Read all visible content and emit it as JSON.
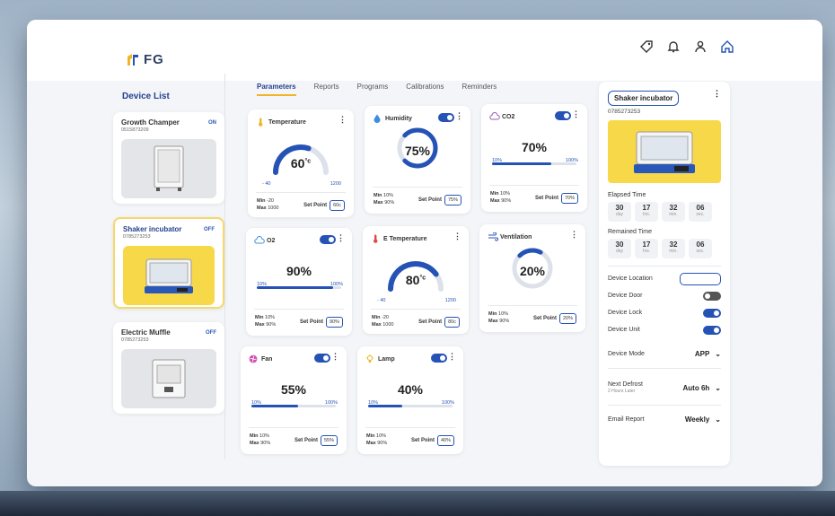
{
  "brand": {
    "logo_text": "FG",
    "accent": "#2553b5",
    "highlight": "#f7d849"
  },
  "top_icons": [
    "tag-icon",
    "bell-icon",
    "user-icon",
    "home-icon"
  ],
  "device_list": {
    "title": "Device List",
    "devices": [
      {
        "name": "Growth Champer",
        "id": "0515873209",
        "status": "ON"
      },
      {
        "name": "Shaker incubator",
        "id": "0785273253",
        "status": "OFF"
      },
      {
        "name": "Electric Muffle",
        "id": "0785273253",
        "status": "OFF"
      }
    ]
  },
  "tabs": [
    "Parameters",
    "Reports",
    "Programs",
    "Calibrations",
    "Reminders"
  ],
  "params": {
    "temperature": {
      "title": "Temperature",
      "value": "60",
      "unit": "°c",
      "gmin": "- 40",
      "gmax": "1200",
      "min": "-20",
      "max": "1000",
      "setpoint": "60c",
      "level": 0.6
    },
    "humidity": {
      "title": "Humidity",
      "value": "75%",
      "min": "10%",
      "max": "90%",
      "setpoint": "75%",
      "level": 0.75
    },
    "co2": {
      "title": "CO2",
      "value": "70%",
      "bmin": "10%",
      "bmax": "100%",
      "min": "10%",
      "max": "90%",
      "setpoint": "70%",
      "level": 0.7
    },
    "o2": {
      "title": "O2",
      "value": "90%",
      "bmin": "10%",
      "bmax": "100%",
      "min": "10%",
      "max": "90%",
      "setpoint": "90%",
      "level": 0.9
    },
    "etemp": {
      "title": "E Temperature",
      "value": "80",
      "unit": "°c",
      "gmin": "- 40",
      "gmax": "1200",
      "min": "-20",
      "max": "1000",
      "setpoint": "80c",
      "level": 0.8
    },
    "ventilation": {
      "title": "Ventilation",
      "value": "20%",
      "min": "10%",
      "max": "90%",
      "setpoint": "20%",
      "level": 0.2
    },
    "fan": {
      "title": "Fan",
      "value": "55%",
      "bmin": "10%",
      "bmax": "100%",
      "min": "10%",
      "max": "90%",
      "setpoint": "55%",
      "level": 0.55
    },
    "lamp": {
      "title": "Lamp",
      "value": "40%",
      "bmin": "10%",
      "bmax": "100%",
      "min": "10%",
      "max": "90%",
      "setpoint": "40%",
      "level": 0.4
    }
  },
  "labels": {
    "min": "Min",
    "max": "Max",
    "set_point": "Set Point"
  },
  "panel": {
    "title": "Shaker incubator",
    "id": "0785273253",
    "elapsed_label": "Elapsed Time",
    "remained_label": "Remained Time",
    "elapsed": [
      {
        "v": "30",
        "u": "day"
      },
      {
        "v": "17",
        "u": "hrs."
      },
      {
        "v": "32",
        "u": "min."
      },
      {
        "v": "06",
        "u": "sec."
      }
    ],
    "remained": [
      {
        "v": "30",
        "u": "day"
      },
      {
        "v": "17",
        "u": "hrs."
      },
      {
        "v": "32",
        "u": "min."
      },
      {
        "v": "06",
        "u": "sec."
      }
    ],
    "location": "Device Location",
    "door": "Device Door",
    "lock": "Device Lock",
    "unit": "Device Unit",
    "mode_label": "Device Mode",
    "mode_value": "APP",
    "defrost_label": "Next Defrost",
    "defrost_sub": "2 Hours Later",
    "defrost_value": "Auto 6h",
    "email_label": "Email Report",
    "email_value": "Weekly"
  }
}
